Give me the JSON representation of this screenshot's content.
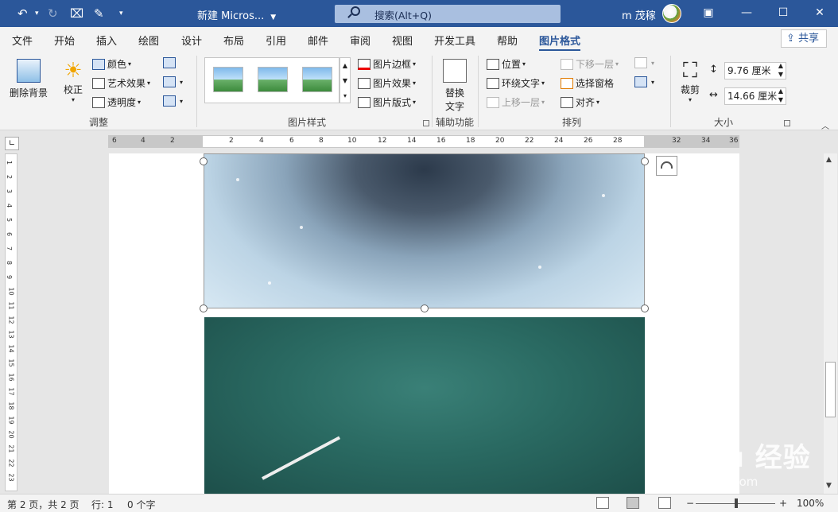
{
  "titlebar": {
    "doc_title": "新建 Micros...",
    "search_placeholder": "搜索(Alt+Q)",
    "user_name": "m 茂稼"
  },
  "tabs": [
    "文件",
    "开始",
    "插入",
    "绘图",
    "设计",
    "布局",
    "引用",
    "邮件",
    "审阅",
    "视图",
    "开发工具",
    "帮助",
    "图片格式"
  ],
  "active_tab": "图片格式",
  "share_label": "共享",
  "ribbon": {
    "adjust": {
      "remove_bg": "删除背景",
      "correct": "校正",
      "color": "颜色",
      "artistic": "艺术效果",
      "transparency": "透明度",
      "group_label": "调整"
    },
    "styles": {
      "border": "图片边框",
      "effects": "图片效果",
      "layout": "图片版式",
      "group_label": "图片样式"
    },
    "accessibility": {
      "alt_text_line1": "替换",
      "alt_text_line2": "文字",
      "group_label": "辅助功能"
    },
    "arrange": {
      "position": "位置",
      "wrap_text": "环绕文字",
      "bring_forward": "上移一层",
      "send_backward": "下移一层",
      "selection_pane": "选择窗格",
      "align": "对齐",
      "group_label": "排列"
    },
    "size": {
      "crop": "裁剪",
      "height": "9.76 厘米",
      "width": "14.66 厘米",
      "group_label": "大小"
    }
  },
  "ruler": {
    "h_ticks": [
      "6",
      "4",
      "2",
      "2",
      "4",
      "6",
      "8",
      "10",
      "12",
      "14",
      "16",
      "18",
      "20",
      "22",
      "24",
      "26",
      "28",
      "32",
      "34",
      "36"
    ],
    "v_ticks": [
      "1",
      "2",
      "3",
      "4",
      "5",
      "6",
      "7",
      "8",
      "9",
      "10",
      "11",
      "12",
      "13",
      "14",
      "15",
      "16",
      "17",
      "18",
      "19",
      "20",
      "21",
      "22",
      "23",
      "24"
    ]
  },
  "watermark": {
    "brand": "Bai du 经验",
    "url": "jingyan.baidu.com"
  },
  "statusbar": {
    "page": "第 2 页，共 2 页",
    "line": "行: 1",
    "words": "0 个字",
    "zoom": "100%",
    "zoom_minus": "−",
    "zoom_plus": "+"
  }
}
